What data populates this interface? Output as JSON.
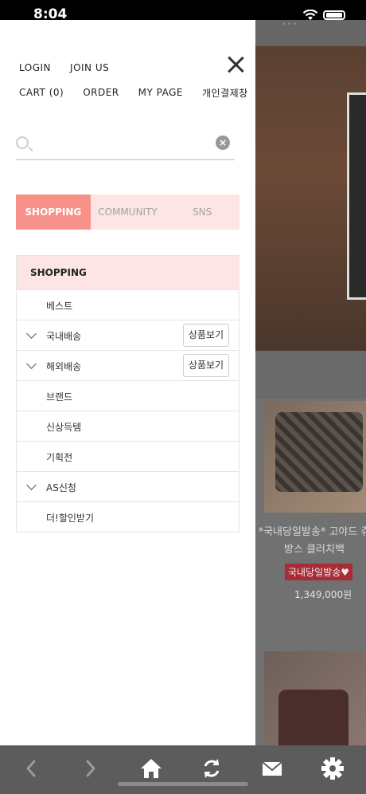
{
  "status_bar": {
    "time": "8:04"
  },
  "drawer": {
    "links_row1": [
      "LOGIN",
      "JOIN US"
    ],
    "links_row2": [
      "CART (0)",
      "ORDER",
      "MY PAGE",
      "개인결제창"
    ],
    "search": {
      "placeholder": "",
      "value": ""
    },
    "tabs": [
      {
        "label": "SHOPPING",
        "active": true
      },
      {
        "label": "COMMUNITY",
        "active": false
      },
      {
        "label": "SNS",
        "active": false
      }
    ],
    "menu": {
      "header": "SHOPPING",
      "items": [
        {
          "label": "베스트",
          "expandable": false
        },
        {
          "label": "국내배송",
          "expandable": true,
          "button": "상품보기"
        },
        {
          "label": "해외배송",
          "expandable": true,
          "button": "상품보기"
        },
        {
          "label": "브랜드",
          "expandable": false
        },
        {
          "label": "신상득템",
          "expandable": false
        },
        {
          "label": "기획전",
          "expandable": false
        },
        {
          "label": "AS신청",
          "expandable": true
        },
        {
          "label": "더!할인받기",
          "expandable": false
        }
      ]
    }
  },
  "background_page": {
    "product_name": "*국내당일발송* 고야드 쥬방스 클러치백",
    "badge": "국내당일발송♥",
    "price": "1,349,000원"
  },
  "toolbar": {
    "buttons": [
      "chevron-left-icon",
      "chevron-right-icon",
      "home-icon",
      "refresh-icon",
      "mail-icon",
      "gear-icon"
    ]
  },
  "colors": {
    "accent": "#f7928b",
    "tab_bar_bg": "#fde5e5",
    "toolbar_bg": "#5c5c5c"
  }
}
